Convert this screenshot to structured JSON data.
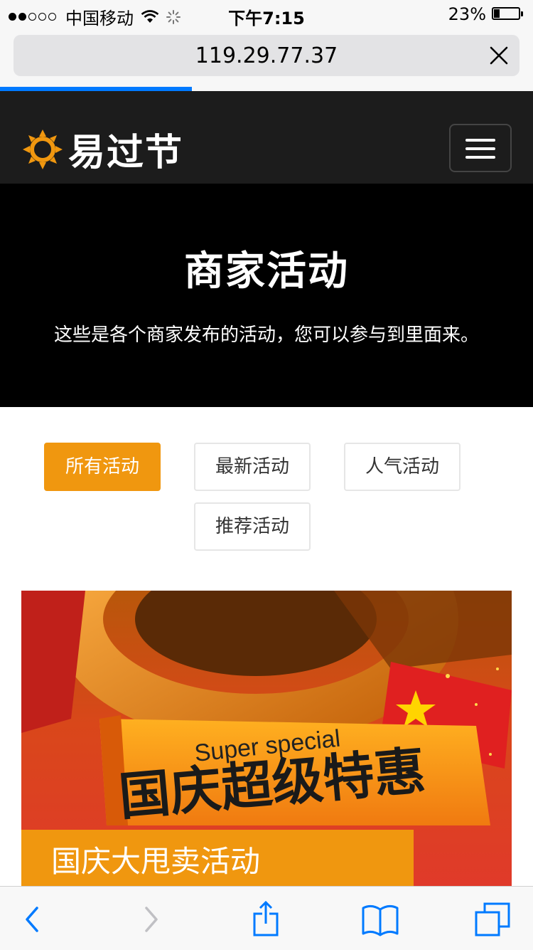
{
  "status_bar": {
    "signal_filled": 2,
    "signal_total": 5,
    "carrier": "中国移动",
    "time": "下午7:15",
    "battery": "23%",
    "battery_fraction": 0.23
  },
  "browser": {
    "url": "119.29.77.37",
    "load_progress": 0.36,
    "accent_color": "#007aff"
  },
  "navbar": {
    "logo_text": "易过节",
    "logo_icon": "sun-icon",
    "menu_icon": "hamburger-icon"
  },
  "hero": {
    "title": "商家活动",
    "description": "这些是各个商家发布的活动，您可以参与到里面来。"
  },
  "filters": {
    "items": [
      {
        "label": "所有活动",
        "active": true
      },
      {
        "label": "最新活动",
        "active": false
      },
      {
        "label": "人气活动",
        "active": false
      },
      {
        "label": "推荐活动",
        "active": false
      }
    ],
    "active_color": "#f0970f"
  },
  "activity": {
    "banner_text_en": "Super special",
    "banner_text_cn": "国庆超级特惠",
    "caption": "国庆大甩卖活动"
  },
  "toolbar": {
    "icons": [
      "back-icon",
      "forward-icon",
      "share-icon",
      "bookmarks-icon",
      "tabs-icon"
    ]
  }
}
